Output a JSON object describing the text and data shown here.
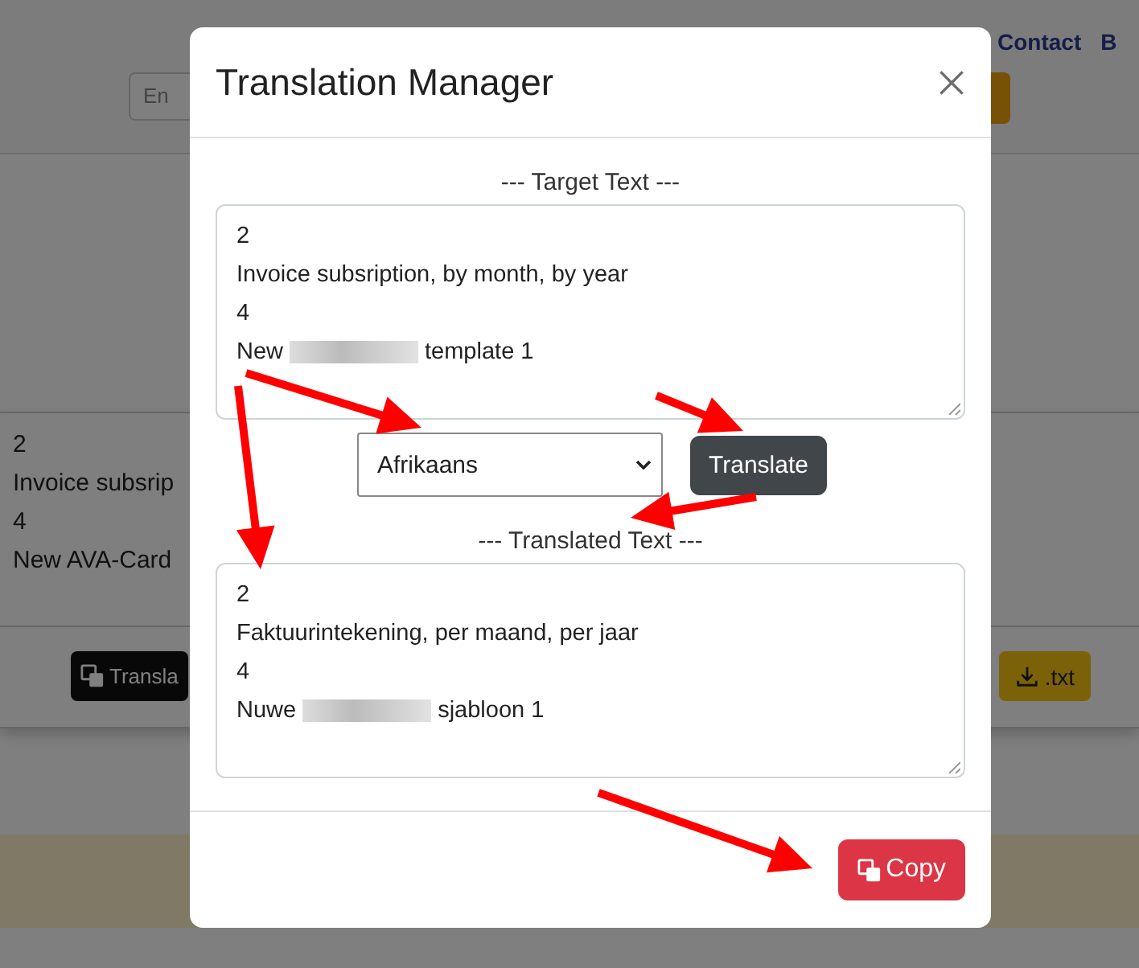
{
  "background_page": {
    "nav_links": [
      "Contact",
      "B"
    ],
    "search": {
      "value": "En"
    },
    "panel_lines": [
      "2",
      "Invoice subsrip",
      "4",
      "New AVA-Card"
    ],
    "translate_button": "Transla",
    "download_button": ".txt"
  },
  "modal": {
    "title": "Translation Manager",
    "target_label": "--- Target Text ---",
    "target_lines": [
      {
        "parts": [
          "2"
        ],
        "redacted": false
      },
      {
        "parts": [
          "Invoice subsription, by month, by year"
        ],
        "redacted": false
      },
      {
        "parts": [
          "4"
        ],
        "redacted": false
      },
      {
        "parts": [
          "New",
          "template 1"
        ],
        "redacted": true
      }
    ],
    "language": "Afrikaans",
    "translate_button": "Translate",
    "translated_label": "--- Translated Text ---",
    "translated_lines": [
      {
        "parts": [
          "2"
        ],
        "redacted": false
      },
      {
        "parts": [
          "Faktuurintekening, per maand, per jaar"
        ],
        "redacted": false
      },
      {
        "parts": [
          "4"
        ],
        "redacted": false
      },
      {
        "parts": [
          "Nuwe",
          "sjabloon 1"
        ],
        "redacted": true
      }
    ],
    "copy_button": "Copy"
  }
}
